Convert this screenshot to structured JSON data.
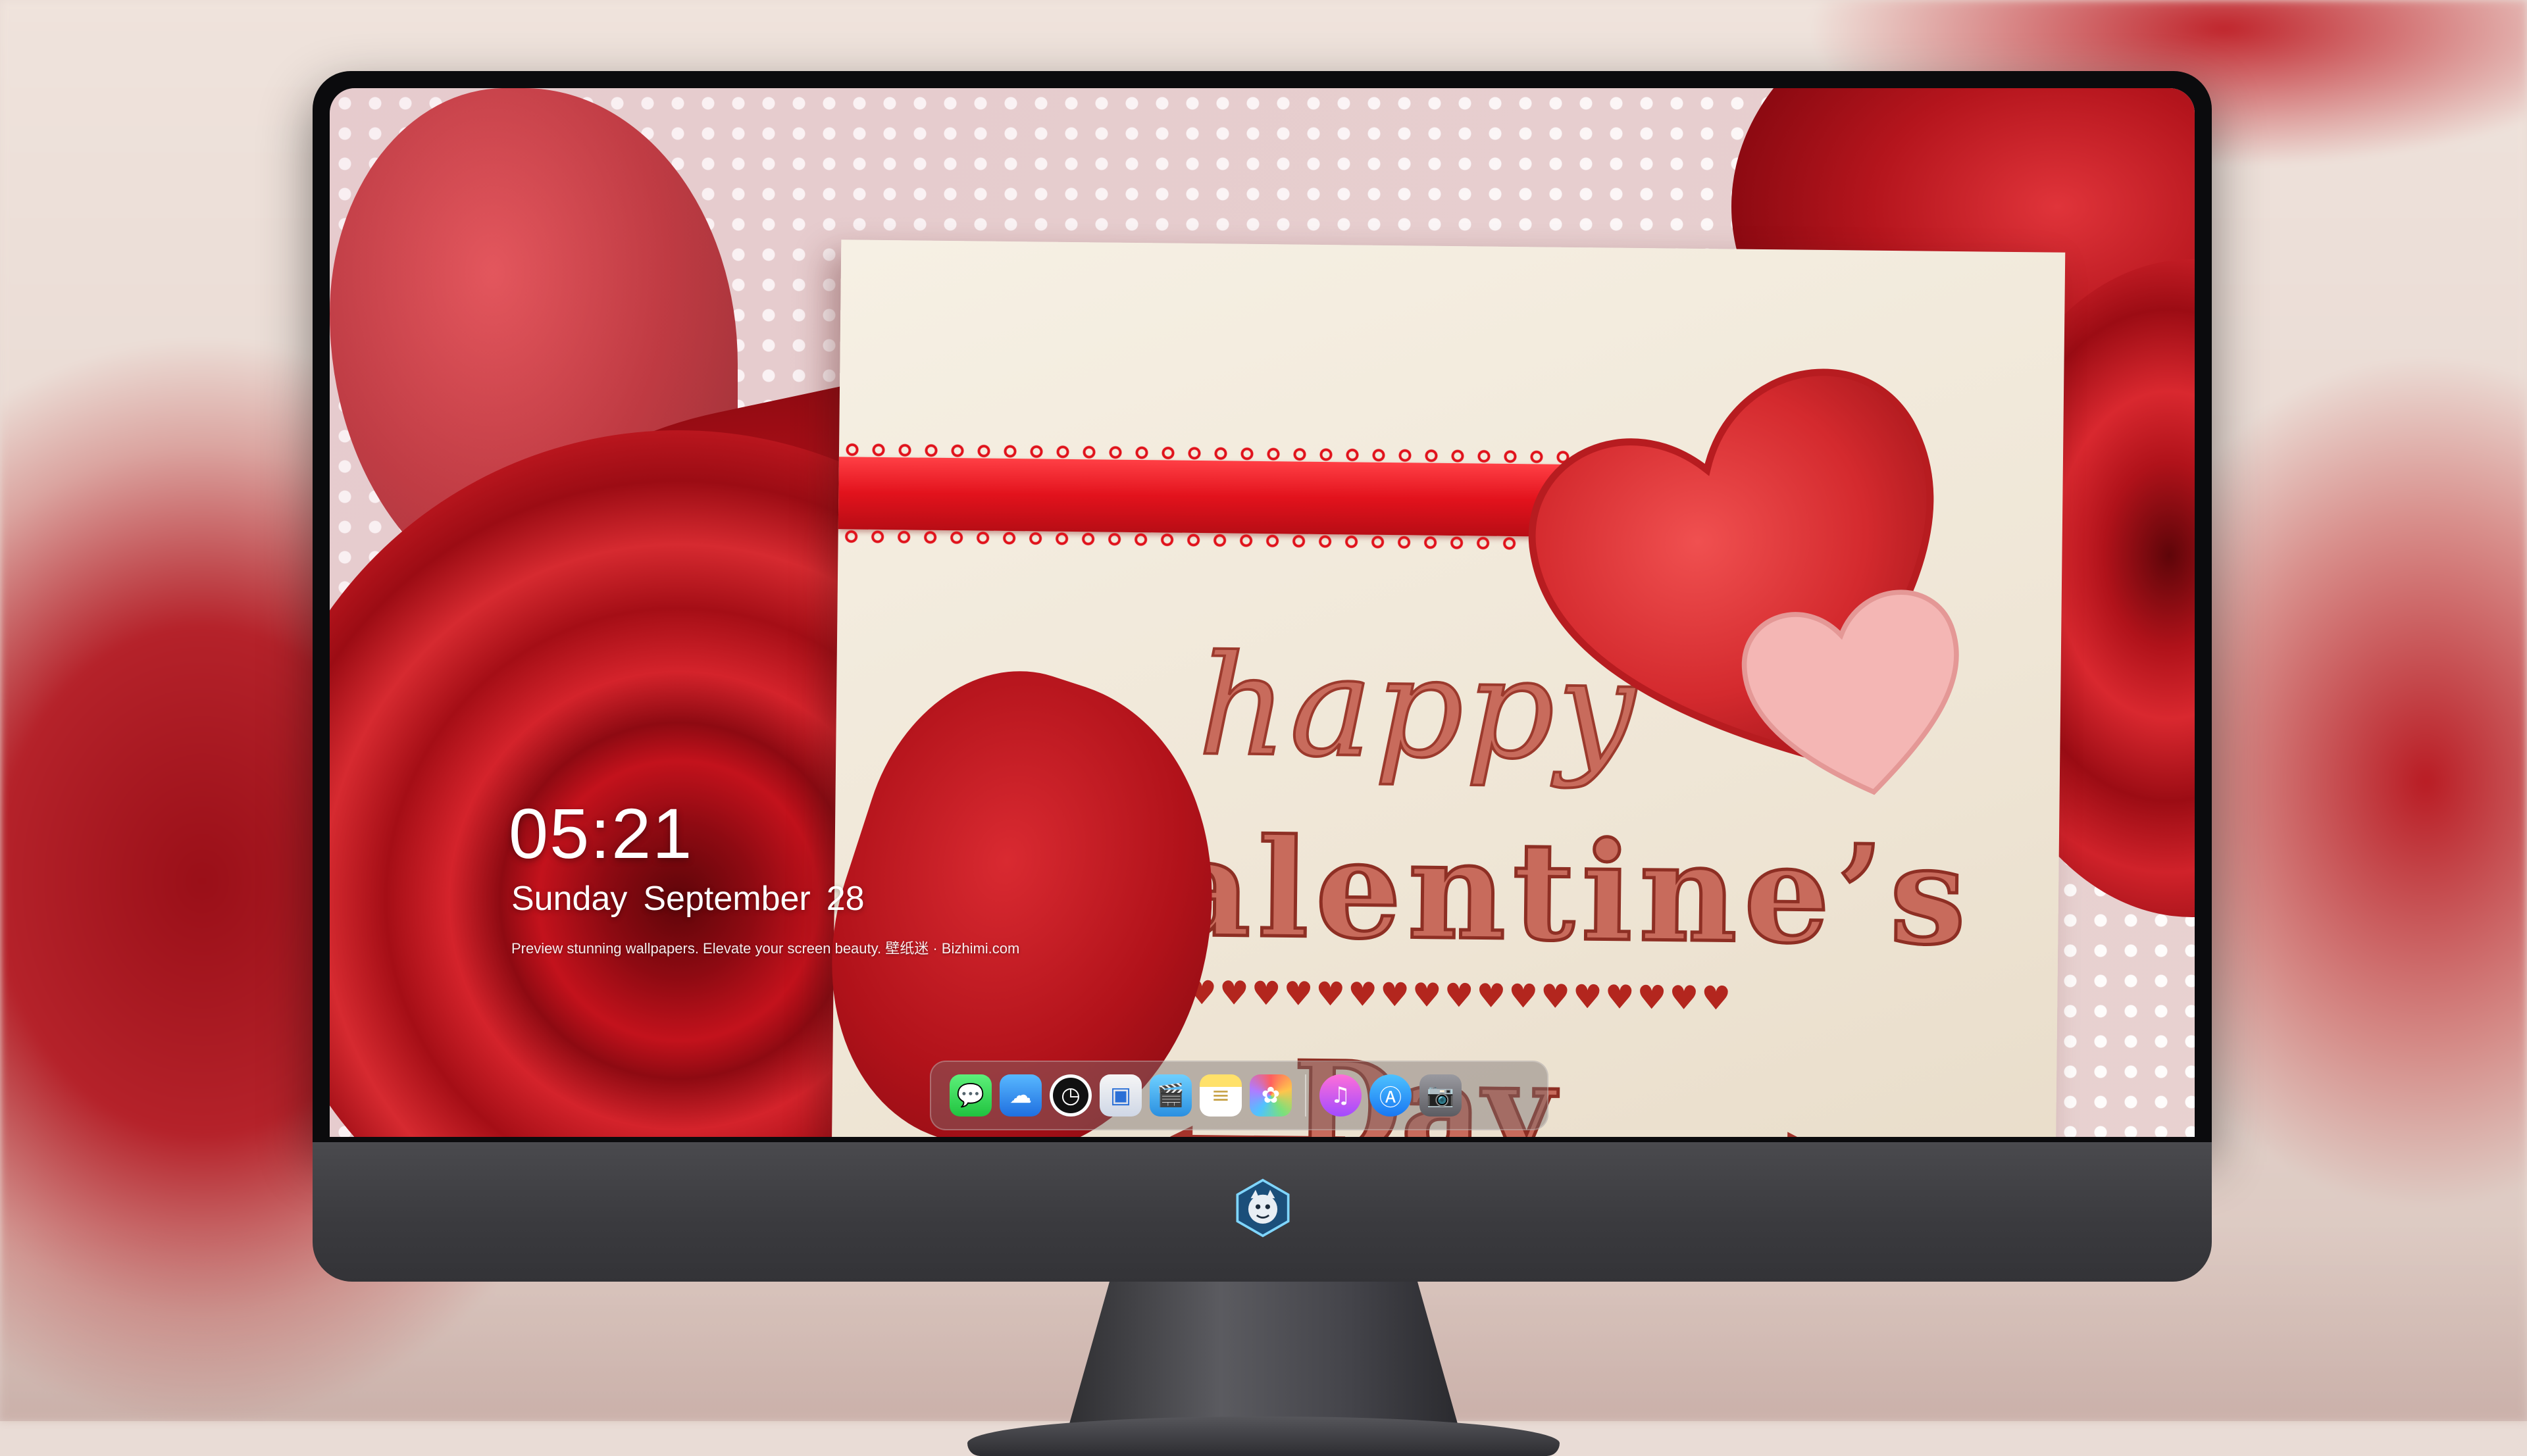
{
  "lockscreen": {
    "time": "05:21",
    "weekday": "Sunday",
    "month": "September",
    "day": "28",
    "tagline": "Preview stunning wallpapers. Elevate your screen beauty. 壁纸迷 · Bizhimi.com"
  },
  "wallpaper": {
    "line1": "happy",
    "line2": "Valentine’s",
    "hearts_row": "♥♥♥♥♥♥♥♥♥♥♥♥♥♥♥♥♥♥♥",
    "line3": "Day",
    "colors": {
      "rose": "#c3121c",
      "card": "#f3ecdf",
      "ribbon": "#e2121c",
      "lettering": "#c86b5c"
    }
  },
  "dock": {
    "items": [
      {
        "name": "messages-icon",
        "glyph": "💬"
      },
      {
        "name": "weather-icon",
        "glyph": "☁"
      },
      {
        "name": "clock-icon",
        "glyph": "◷"
      },
      {
        "name": "preview-icon",
        "glyph": "▣"
      },
      {
        "name": "video-icon",
        "glyph": "🎬"
      },
      {
        "name": "notes-icon",
        "glyph": "≡"
      },
      {
        "name": "photos-icon",
        "glyph": "✿"
      },
      {
        "name": "music-icon",
        "glyph": "♫"
      },
      {
        "name": "app-store-icon",
        "glyph": "Ⓐ"
      },
      {
        "name": "camera-icon",
        "glyph": "📷"
      }
    ]
  },
  "chin": {
    "logo_icon": "mascot-shield-icon"
  }
}
